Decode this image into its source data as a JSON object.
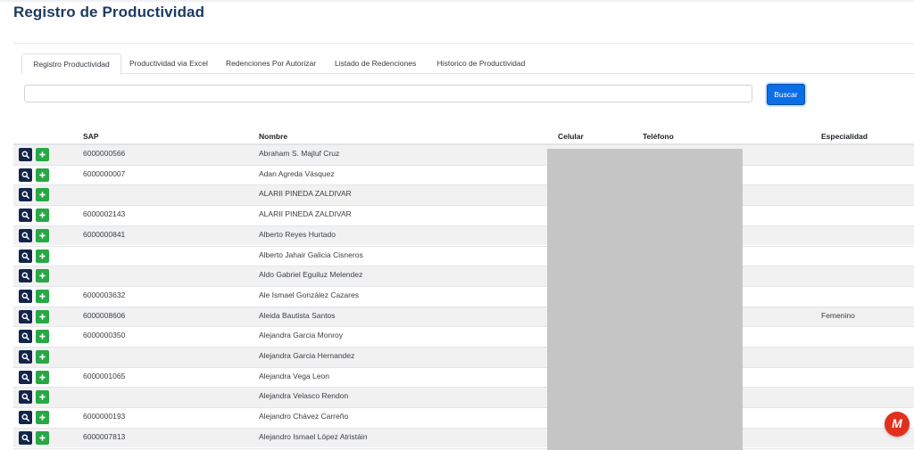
{
  "page": {
    "title": "Registro de Productividad"
  },
  "tabs": [
    {
      "label": "Registro Productividad",
      "active": true
    },
    {
      "label": "Productividad via Excel",
      "active": false
    },
    {
      "label": "Redenciones Por Autorizar",
      "active": false
    },
    {
      "label": "Listado de Redenciones",
      "active": false
    },
    {
      "label": "Historico de Productividad",
      "active": false
    }
  ],
  "search": {
    "value": "",
    "placeholder": "",
    "button_label": "Buscar"
  },
  "table": {
    "columns": {
      "sap": "SAP",
      "nombre": "Nombre",
      "celular": "Celular",
      "telefono": "Teléfono",
      "especialidad": "Especialidad"
    },
    "rows": [
      {
        "sap": "6000000566",
        "nombre": "Abraham S. Majluf Cruz",
        "especialidad": ""
      },
      {
        "sap": "6000000007",
        "nombre": "Adan Agreda Vásquez",
        "especialidad": ""
      },
      {
        "sap": "",
        "nombre": "ALARII PINEDA ZALDIVAR",
        "especialidad": ""
      },
      {
        "sap": "6000002143",
        "nombre": "ALARII PINEDA ZALDIVAR",
        "especialidad": ""
      },
      {
        "sap": "6000000841",
        "nombre": "Alberto Reyes Hurtado",
        "especialidad": ""
      },
      {
        "sap": "",
        "nombre": "Alberto Jahair Galicia Cisneros",
        "especialidad": ""
      },
      {
        "sap": "",
        "nombre": "Aldo Gabriel Eguiluz Melendez",
        "especialidad": ""
      },
      {
        "sap": "6000003632",
        "nombre": "Ale Ismael González Cazares",
        "especialidad": ""
      },
      {
        "sap": "6000008606",
        "nombre": "Aleida Bautista Santos",
        "especialidad": "Femenino"
      },
      {
        "sap": "6000000350",
        "nombre": "Alejandra Garcia Monroy",
        "especialidad": ""
      },
      {
        "sap": "",
        "nombre": "Alejandra Garcia Hernandez",
        "especialidad": ""
      },
      {
        "sap": "6000001065",
        "nombre": "Alejandra Vega Leon",
        "especialidad": ""
      },
      {
        "sap": "",
        "nombre": "Alejandra Velasco Rendon",
        "especialidad": ""
      },
      {
        "sap": "6000000193",
        "nombre": "Alejandro Chávez Carreño",
        "especialidad": ""
      },
      {
        "sap": "6000007813",
        "nombre": "Alejandro Ismael López Atristáin",
        "especialidad": ""
      },
      {
        "sap": "",
        "nombre": "",
        "especialidad": ""
      }
    ]
  },
  "colors": {
    "title": "#1d3a5f",
    "view_button": "#14254a",
    "add_button": "#28a745",
    "primary": "#0a6ee6",
    "badge": "#e1301d"
  },
  "icons": {
    "view": "search-icon",
    "add": "plus-icon",
    "chat": "m-logo-icon"
  }
}
